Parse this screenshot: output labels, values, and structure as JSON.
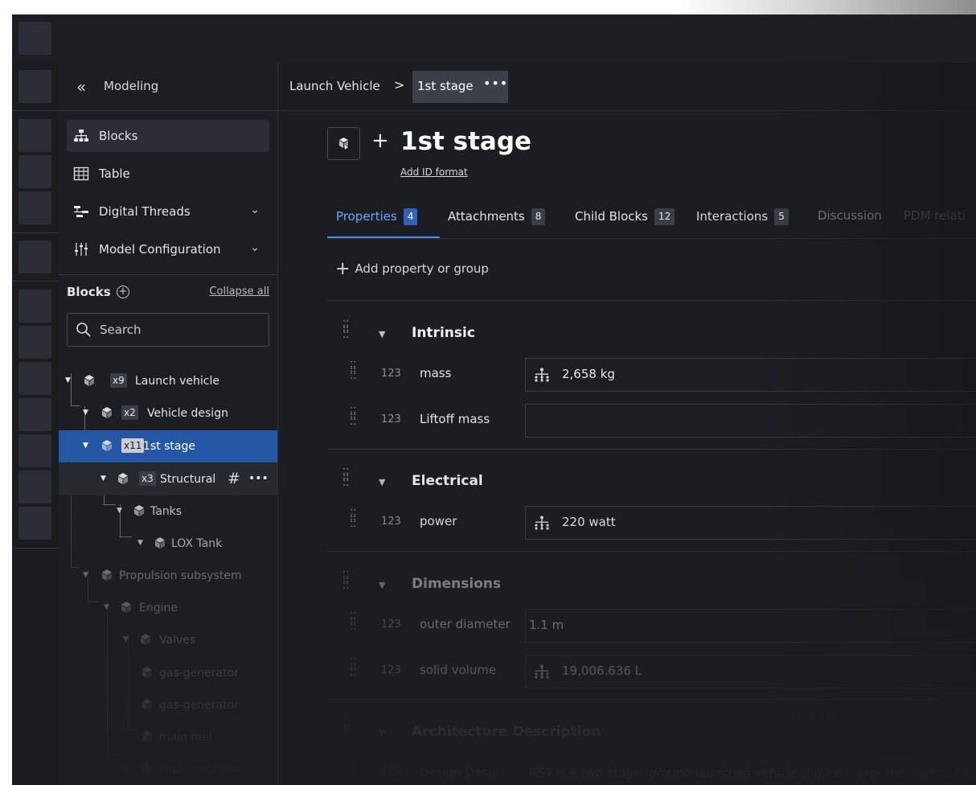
{
  "header": {
    "module_title": "Modeling"
  },
  "nav": [
    {
      "label": "Blocks",
      "icon": "hierarchy-icon"
    },
    {
      "label": "Table",
      "icon": "table-icon"
    },
    {
      "label": "Digital Threads",
      "icon": "digital-threads-icon"
    },
    {
      "label": "Model Configuration",
      "icon": "sliders-icon"
    }
  ],
  "tree": {
    "title": "Blocks",
    "collapse_all": "Collapse all",
    "search_placeholder": "Search",
    "rows": [
      {
        "label": "Launch vehicle",
        "badge": "x9"
      },
      {
        "label": "Vehicle design",
        "badge": "x2"
      },
      {
        "label": "1st stage",
        "badge": "x11"
      },
      {
        "label": "Structural",
        "badge": "x3",
        "hash": "#",
        "more": "•••"
      },
      {
        "label": "Tanks"
      },
      {
        "label": "LOX Tank"
      },
      {
        "label": "Propulsion subsystem"
      },
      {
        "label": "Engine"
      },
      {
        "label": "Valves"
      },
      {
        "label": "gas-generator"
      },
      {
        "label": "gas-generator"
      },
      {
        "label": "main fuel"
      },
      {
        "label": "Main combusti..."
      }
    ]
  },
  "breadcrumb": {
    "parent": "Launch Vehicle",
    "separator": ">",
    "current": "1st stage",
    "more": "•••"
  },
  "block": {
    "plus": "+",
    "title": "1st stage",
    "add_id": "Add ID format"
  },
  "tabs": [
    {
      "label": "Properties",
      "count": "4"
    },
    {
      "label": "Attachments",
      "count": "8"
    },
    {
      "label": "Child Blocks",
      "count": "12"
    },
    {
      "label": "Interactions",
      "count": "5"
    },
    {
      "label": "Discussion"
    },
    {
      "label": "PDM relati"
    }
  ],
  "add_property": "Add property or group",
  "groups": [
    {
      "title": "Intrinsic",
      "properties": [
        {
          "num": "123",
          "name": "mass",
          "value": "2,658 kg",
          "icon": "tree-icon"
        },
        {
          "num": "123",
          "name": "Liftoff mass",
          "value": ""
        }
      ]
    },
    {
      "title": "Electrical",
      "properties": [
        {
          "num": "123",
          "name": "power",
          "value": "220 watt",
          "icon": "tree-icon"
        }
      ]
    },
    {
      "title": "Dimensions",
      "properties": [
        {
          "num": "123",
          "name": "outer diameter",
          "value": "1.1 m"
        },
        {
          "num": "123",
          "name": "solid volume",
          "value": "19,006.636 L",
          "icon": "tree-icon"
        }
      ]
    },
    {
      "title": "Architecture Description",
      "properties": [
        {
          "num": "123",
          "name": "Design Des...",
          "value": "RST is a two-stage, ground-launched vehicle (figure ...) for the user ... operation"
        }
      ]
    }
  ],
  "colors": {
    "accent": "#4a8cff",
    "selected_row": "#2458a6",
    "background": "#1b1d22"
  }
}
